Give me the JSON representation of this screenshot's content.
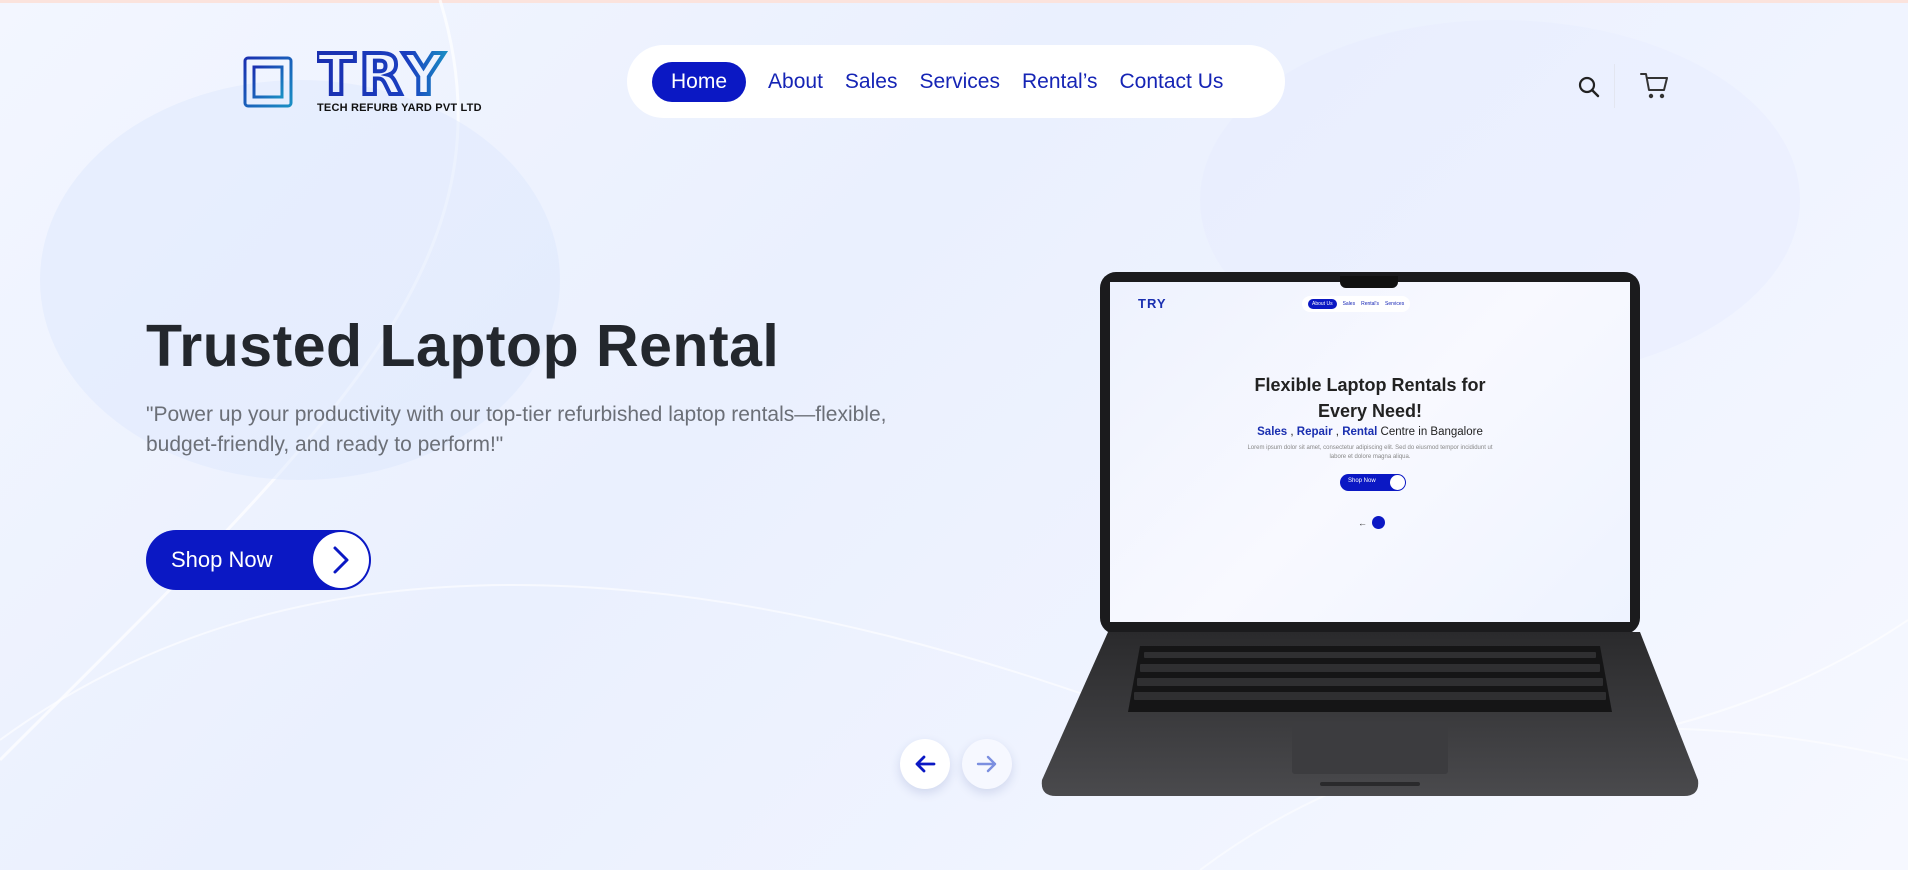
{
  "brand": {
    "wordmark": "TRY",
    "company": "TECH REFURB YARD PVT LTD",
    "colors": {
      "primary": "#0b18c4",
      "logo_blue": "#1a2fb0",
      "logo_teal": "#1a8fc4",
      "heading": "#23272d",
      "subtext": "#6b6f77"
    }
  },
  "nav": {
    "items": [
      {
        "label": "Home",
        "active": true
      },
      {
        "label": "About",
        "active": false
      },
      {
        "label": "Sales",
        "active": false
      },
      {
        "label": "Services",
        "active": false
      },
      {
        "label": "Rental’s",
        "active": false
      },
      {
        "label": "Contact Us",
        "active": false
      }
    ]
  },
  "header_icons": {
    "search": "search-icon",
    "cart": "cart-icon"
  },
  "hero": {
    "title": "Trusted Laptop Rental",
    "subtitle": "\"Power up your productivity with our top-tier refurbished laptop rentals—flexible, budget-friendly, and ready to perform!\"",
    "cta_label": "Shop Now",
    "cta_icon": "chevron-right-icon"
  },
  "carousel": {
    "prev_icon": "arrow-left-icon",
    "next_icon": "arrow-right-icon"
  },
  "laptop_screen": {
    "logo": "TRY",
    "nav": [
      "About Us",
      "Sales",
      "Rental's",
      "Services"
    ],
    "title_line1": "Flexible Laptop Rentals for",
    "title_line2": "Every Need!",
    "tag_sales": "Sales",
    "tag_repair": "Repair",
    "tag_rental": "Rental",
    "tag_rest": "Centre in Bangalore",
    "lorem": "Lorem ipsum dolor sit amet, consectetur adipiscing elit. Sed do eiusmod tempor incididunt ut labore et dolore magna aliqua.",
    "cta_label": "Shop Now"
  }
}
